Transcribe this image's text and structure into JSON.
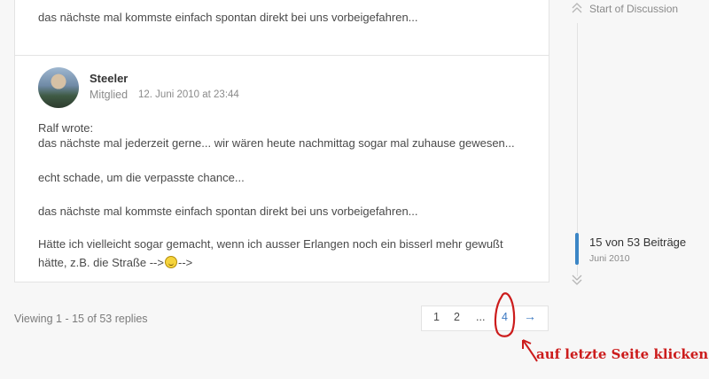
{
  "posts": [
    {
      "body_lines": [
        "das nächste mal kommste einfach spontan direkt bei uns vorbeigefahren..."
      ]
    },
    {
      "author": "Steeler",
      "role": "Mitglied",
      "date": "12. Juni 2010 at 23:44",
      "quote_header": "Ralf wrote:",
      "quote_line": "das nächste mal jederzeit gerne... wir wären heute nachmittag sogar mal zuhause gewesen...",
      "line2": "echt schade, um die verpasste chance...",
      "line3": "das nächste mal kommste einfach spontan direkt bei uns vorbeigefahren...",
      "line4a": "Hätte ich vielleicht sogar gemacht, wenn ich ausser Erlangen noch ein bisserl mehr gewußt",
      "line4b_before": "hätte, z.B. die Straße -->",
      "line4b_after": "-->"
    }
  ],
  "footer": {
    "viewing": "Viewing 1 - 15 of 53 replies"
  },
  "pagination": {
    "pages": [
      "1",
      "2",
      "...",
      "4"
    ],
    "next": "→"
  },
  "timeline": {
    "start_label": "Start of Discussion",
    "count": "15 von 53 Beiträge",
    "date": "Juni 2010"
  },
  "annotation": {
    "text": "auf letzte Seite klicken",
    "color": "#cc1c1c"
  },
  "colors": {
    "accent": "#3b78c2",
    "timeline_marker": "#3b86c6"
  }
}
